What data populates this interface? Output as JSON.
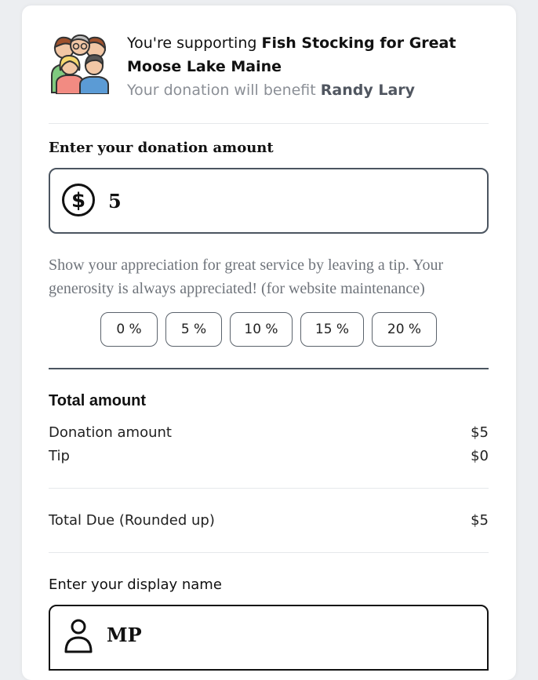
{
  "header": {
    "supporting_prefix": "You're supporting ",
    "campaign_name": "Fish Stocking for Great Moose Lake Maine",
    "benefit_prefix": "Your donation will benefit ",
    "beneficiary": "Randy Lary",
    "illustration": "group-of-people-icon"
  },
  "donation": {
    "label": "Enter your donation amount",
    "icon": "dollar-circle-icon",
    "value": "5"
  },
  "tip": {
    "message": "Show your appreciation for great service by leaving a tip. Your generosity is always appreciated! (for website maintenance)",
    "options": [
      "0 %",
      "5 %",
      "10 %",
      "15 %",
      "20 %"
    ]
  },
  "totals": {
    "title": "Total amount",
    "donation_label": "Donation amount",
    "donation_value": "$5",
    "tip_label": "Tip",
    "tip_value": "$0",
    "due_label": "Total Due (Rounded up)",
    "due_value": "$5"
  },
  "display_name": {
    "label": "Enter your display name",
    "icon": "person-icon",
    "value": "MP"
  }
}
